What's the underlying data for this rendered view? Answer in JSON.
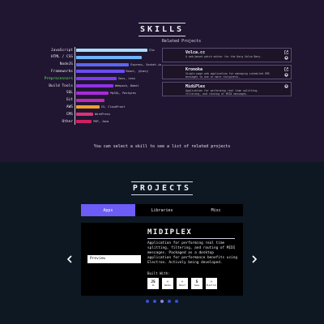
{
  "skills": {
    "title": "SKILLS",
    "hint": "You can select a skill to see a list of related projects",
    "items": [
      {
        "label": "JavaScript",
        "value": 0.92,
        "color": "#a8dcff",
        "note": "Elm"
      },
      {
        "label": "HTML / CSS",
        "value": 0.84,
        "color": "#6fb3ff",
        "note": ""
      },
      {
        "label": "NodeJS",
        "value": 0.68,
        "color": "#5a67f0",
        "note": "Express, Socket.io"
      },
      {
        "label": "Frameworks",
        "value": 0.62,
        "color": "#6b4df0",
        "note": "React, jQuery"
      },
      {
        "label": "Preprocessors",
        "value": 0.52,
        "color": "#7d3cf0",
        "note": "Sass, Less",
        "active": true
      },
      {
        "label": "Build Tools",
        "value": 0.48,
        "color": "#8f32e6",
        "note": "Webpack, Babel"
      },
      {
        "label": "SQL",
        "value": 0.42,
        "color": "#a82ad8",
        "note": "MySQL, Postgres"
      },
      {
        "label": "Git",
        "value": 0.36,
        "color": "#c027b8",
        "note": ""
      },
      {
        "label": "AWS",
        "value": 0.3,
        "color": "#f0a030",
        "note": "S3, CloudFront"
      },
      {
        "label": "CMS",
        "value": 0.22,
        "color": "#e0307a",
        "note": "WordPress"
      },
      {
        "label": "Other",
        "value": 0.2,
        "color": "#d02060",
        "note": "PHP, Java"
      }
    ]
  },
  "related": {
    "heading": "Related Projects",
    "projects": [
      {
        "name": "Volca.cc",
        "desc": "A web-based patch editor for the Korg Volca Bass."
      },
      {
        "name": "Kronoka",
        "desc": "Single page web application for managing scheduled SMS messages to one or more recipients."
      },
      {
        "name": "MidiPlex",
        "desc": "Application for performing real time splitting, filtering, and routing of MIDI messages."
      }
    ]
  },
  "projects": {
    "title": "PROJECTS",
    "tabs": [
      {
        "label": "Apps",
        "active": true
      },
      {
        "label": "Libraries",
        "active": false
      },
      {
        "label": "Misc",
        "active": false
      }
    ],
    "current": {
      "name": "MIDIPLEX",
      "preview_label": "Preview",
      "description": "Application for performing real time splitting, filtering, and routing of MIDI messages. Packaged as a desktop application for performance benefits using Electron. Actively being developed.",
      "built_with_label": "Built With:",
      "tech": [
        {
          "icon": "JS",
          "label": "JS"
        },
        {
          "icon": "⚛",
          "label": "Redux"
        },
        {
          "icon": "⚛",
          "label": "React"
        },
        {
          "icon": "S",
          "label": "Sass"
        },
        {
          "icon": "⚛",
          "label": "Electron"
        }
      ]
    },
    "dots": [
      false,
      false,
      true,
      false,
      false
    ]
  }
}
